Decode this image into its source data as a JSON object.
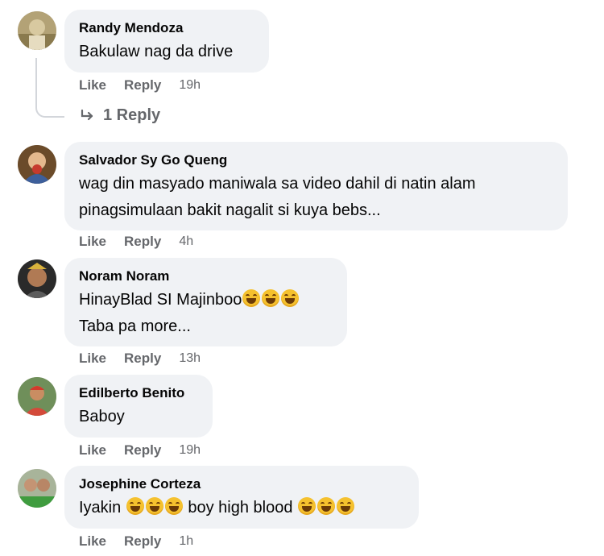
{
  "comments": [
    {
      "author": "Randy Mendoza",
      "lines": [
        "Bakulaw nag da drive"
      ],
      "like": "Like",
      "reply": "Reply",
      "time": "19h"
    },
    {
      "author": "Salvador Sy Go Queng",
      "lines": [
        "wag din masyado maniwala sa video dahil di natin alam",
        "pinagsimulaan bakit nagalit si kuya bebs..."
      ],
      "like": "Like",
      "reply": "Reply",
      "time": "4h"
    },
    {
      "author": "Noram Noram",
      "lines": [
        "HinayBlad SI Majinboo",
        "Taba pa more..."
      ],
      "like": "Like",
      "reply": "Reply",
      "time": "13h"
    },
    {
      "author": "Edilberto Benito",
      "lines": [
        "Baboy"
      ],
      "like": "Like",
      "reply": "Reply",
      "time": "19h"
    },
    {
      "author": "Josephine Corteza",
      "text_before": "Iyakin",
      "text_middle": "boy high blood",
      "like": "Like",
      "reply": "Reply",
      "time": "1h"
    }
  ],
  "replies_link": "1 Reply",
  "emoji_name": "rolling-on-floor-laughing",
  "colors": {
    "bubble": "#f0f2f5",
    "muted": "#65676b",
    "text": "#050505"
  }
}
